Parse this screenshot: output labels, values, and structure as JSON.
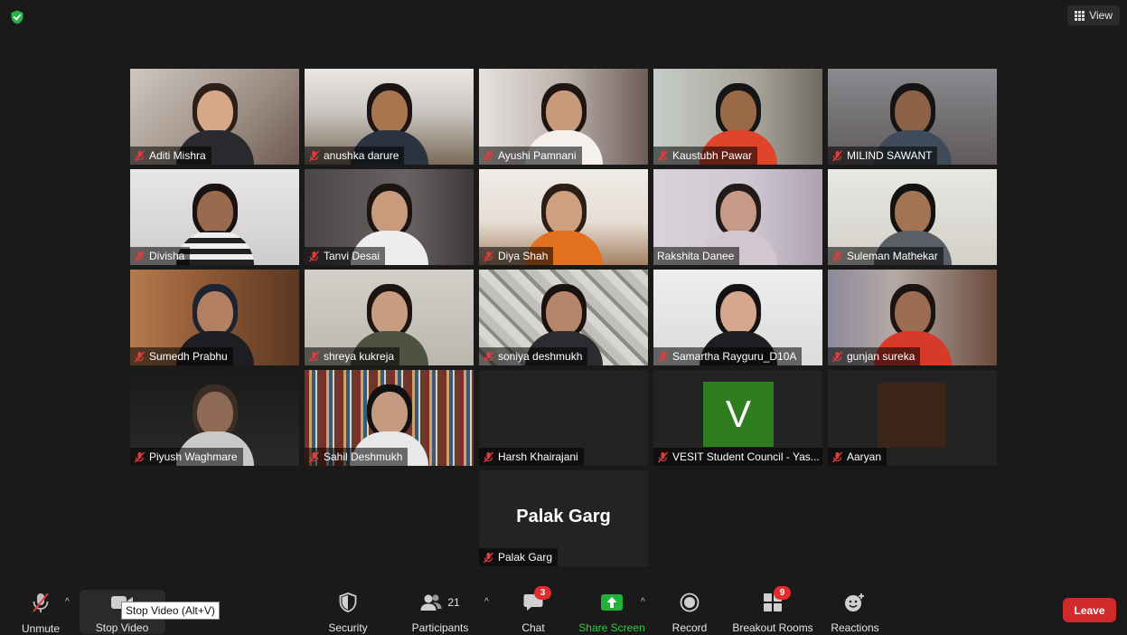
{
  "top_bar": {
    "view_label": "View"
  },
  "participants": [
    {
      "name": "Aditi Mishra"
    },
    {
      "name": "anushka darure"
    },
    {
      "name": "Ayushi Pamnani"
    },
    {
      "name": "Kaustubh Pawar"
    },
    {
      "name": "MILIND SAWANT"
    },
    {
      "name": "Divisha"
    },
    {
      "name": "Tanvi Desai"
    },
    {
      "name": "Diya Shah"
    },
    {
      "name": "Rakshita Danee",
      "active_speaker": true
    },
    {
      "name": "Suleman Mathekar"
    },
    {
      "name": "Sumedh Prabhu"
    },
    {
      "name": "shreya kukreja"
    },
    {
      "name": "soniya deshmukh"
    },
    {
      "name": "Samartha Rayguru_D10A"
    },
    {
      "name": "gunjan sureka"
    },
    {
      "name": "Piyush Waghmare"
    },
    {
      "name": "Sahil Deshmukh"
    },
    {
      "name": "Harsh Khairajani"
    },
    {
      "name": "VESIT Student Council - Yas...",
      "avatar_letter": "V",
      "avatar_color": "#2e7d1e"
    },
    {
      "name": "Aaryan"
    },
    {
      "name": "Palak Garg",
      "display_name": "Palak Garg"
    }
  ],
  "toolbar": {
    "unmute_label": "Unmute",
    "stop_video_label": "Stop Video",
    "stop_video_tooltip": "Stop Video (Alt+V)",
    "security_label": "Security",
    "participants_label": "Participants",
    "participants_count": "21",
    "chat_label": "Chat",
    "chat_badge": "3",
    "share_screen_label": "Share Screen",
    "record_label": "Record",
    "breakout_rooms_label": "Breakout Rooms",
    "breakout_badge": "9",
    "reactions_label": "Reactions",
    "leave_label": "Leave"
  },
  "colors": {
    "background": "#1a1a1a",
    "tile_background": "#232323",
    "active_speaker_border": "#c9d94a",
    "leave_button": "#d02a2a",
    "share_screen_green": "#2ecc40",
    "badge_red": "#e02d2d",
    "muted_red": "#e03c3c"
  },
  "icons": [
    "shield-check-icon",
    "grid-view-icon",
    "muted-mic-icon",
    "video-camera-icon",
    "security-shield-icon",
    "participants-icon",
    "chat-bubble-icon",
    "share-screen-arrow-icon",
    "record-icon",
    "breakout-rooms-icon",
    "reactions-smiley-icon"
  ]
}
